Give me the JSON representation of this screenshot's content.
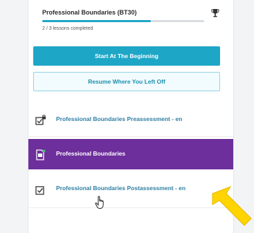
{
  "course": {
    "title": "Professional Boundaries (BT30)",
    "progress_fraction": 0.67,
    "lessons_completed": "2 / 3 lessons completed"
  },
  "buttons": {
    "start_label": "Start At The Beginning",
    "resume_label": "Resume Where You Left Off"
  },
  "lessons": [
    {
      "label": "Professional Boundaries Preassessment - en",
      "icon": "locked-checkbox-icon",
      "active": false
    },
    {
      "label": "Professional Boundaries",
      "icon": "document-icon",
      "active": true
    },
    {
      "label": "Professional Boundaries Postassessment - en",
      "icon": "checkbox-icon",
      "active": false
    }
  ],
  "colors": {
    "accent": "#1ea6c7",
    "active_row": "#6d2f9b",
    "lesson_text": "#2f7fa3",
    "annotation_arrow": "#ffd400"
  }
}
